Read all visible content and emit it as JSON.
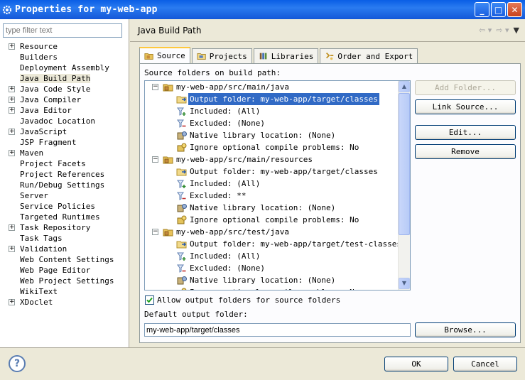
{
  "window": {
    "title": "Properties for my-web-app",
    "minimize": "_",
    "maximize": "□",
    "close": "✕"
  },
  "filter": {
    "placeholder": "type filter text"
  },
  "nav": [
    {
      "label": "Resource",
      "expandable": true
    },
    {
      "label": "Builders",
      "expandable": false
    },
    {
      "label": "Deployment Assembly",
      "expandable": false
    },
    {
      "label": "Java Build Path",
      "expandable": false,
      "selected": true
    },
    {
      "label": "Java Code Style",
      "expandable": true
    },
    {
      "label": "Java Compiler",
      "expandable": true
    },
    {
      "label": "Java Editor",
      "expandable": true
    },
    {
      "label": "Javadoc Location",
      "expandable": false
    },
    {
      "label": "JavaScript",
      "expandable": true
    },
    {
      "label": "JSP Fragment",
      "expandable": false
    },
    {
      "label": "Maven",
      "expandable": true
    },
    {
      "label": "Project Facets",
      "expandable": false
    },
    {
      "label": "Project References",
      "expandable": false
    },
    {
      "label": "Run/Debug Settings",
      "expandable": false
    },
    {
      "label": "Server",
      "expandable": false
    },
    {
      "label": "Service Policies",
      "expandable": false
    },
    {
      "label": "Targeted Runtimes",
      "expandable": false
    },
    {
      "label": "Task Repository",
      "expandable": true
    },
    {
      "label": "Task Tags",
      "expandable": false
    },
    {
      "label": "Validation",
      "expandable": true
    },
    {
      "label": "Web Content Settings",
      "expandable": false
    },
    {
      "label": "Web Page Editor",
      "expandable": false
    },
    {
      "label": "Web Project Settings",
      "expandable": false
    },
    {
      "label": "WikiText",
      "expandable": false
    },
    {
      "label": "XDoclet",
      "expandable": true
    }
  ],
  "page": {
    "title": "Java Build Path"
  },
  "tabs": [
    {
      "label": "Source",
      "icon": "source-folder-icon",
      "active": true
    },
    {
      "label": "Projects",
      "icon": "projects-icon"
    },
    {
      "label": "Libraries",
      "icon": "libraries-icon"
    },
    {
      "label": "Order and Export",
      "icon": "order-export-icon"
    }
  ],
  "source": {
    "section_label": "Source folders on build path:",
    "tree": [
      {
        "level": 0,
        "label": "my-web-app/src/main/java",
        "icon": "package-folder-icon"
      },
      {
        "level": 1,
        "label": "Output folder: my-web-app/target/classes",
        "icon": "output-folder-icon",
        "selected": true
      },
      {
        "level": 1,
        "label": "Included: (All)",
        "icon": "inclusion-filter-icon"
      },
      {
        "level": 1,
        "label": "Excluded: (None)",
        "icon": "exclusion-filter-icon"
      },
      {
        "level": 1,
        "label": "Native library location: (None)",
        "icon": "native-library-icon"
      },
      {
        "level": 1,
        "label": "Ignore optional compile problems: No",
        "icon": "ignore-problems-icon"
      },
      {
        "level": 0,
        "label": "my-web-app/src/main/resources",
        "icon": "package-folder-icon"
      },
      {
        "level": 1,
        "label": "Output folder: my-web-app/target/classes",
        "icon": "output-folder-icon"
      },
      {
        "level": 1,
        "label": "Included: (All)",
        "icon": "inclusion-filter-icon"
      },
      {
        "level": 1,
        "label": "Excluded: **",
        "icon": "exclusion-filter-icon"
      },
      {
        "level": 1,
        "label": "Native library location: (None)",
        "icon": "native-library-icon"
      },
      {
        "level": 1,
        "label": "Ignore optional compile problems: No",
        "icon": "ignore-problems-icon"
      },
      {
        "level": 0,
        "label": "my-web-app/src/test/java",
        "icon": "package-folder-icon"
      },
      {
        "level": 1,
        "label": "Output folder: my-web-app/target/test-classes",
        "icon": "output-folder-icon"
      },
      {
        "level": 1,
        "label": "Included: (All)",
        "icon": "inclusion-filter-icon"
      },
      {
        "level": 1,
        "label": "Excluded: (None)",
        "icon": "exclusion-filter-icon"
      },
      {
        "level": 1,
        "label": "Native library location: (None)",
        "icon": "native-library-icon"
      },
      {
        "level": 1,
        "label": "Ignore optional compile problems: No",
        "icon": "ignore-problems-icon"
      }
    ],
    "buttons": {
      "add_folder": "Add Folder...",
      "link_source": "Link Source...",
      "edit": "Edit...",
      "remove": "Remove"
    },
    "allow_output_label": "Allow output folders for source folders",
    "allow_output_checked": true,
    "default_output_label": "Default output folder:",
    "default_output_value": "my-web-app/target/classes",
    "browse": "Browse..."
  },
  "footer": {
    "ok": "OK",
    "cancel": "Cancel",
    "help": "?"
  },
  "colors": {
    "selection": "#316ac5",
    "titlebar": "#0a5ee5",
    "panel": "#ece9d8"
  }
}
